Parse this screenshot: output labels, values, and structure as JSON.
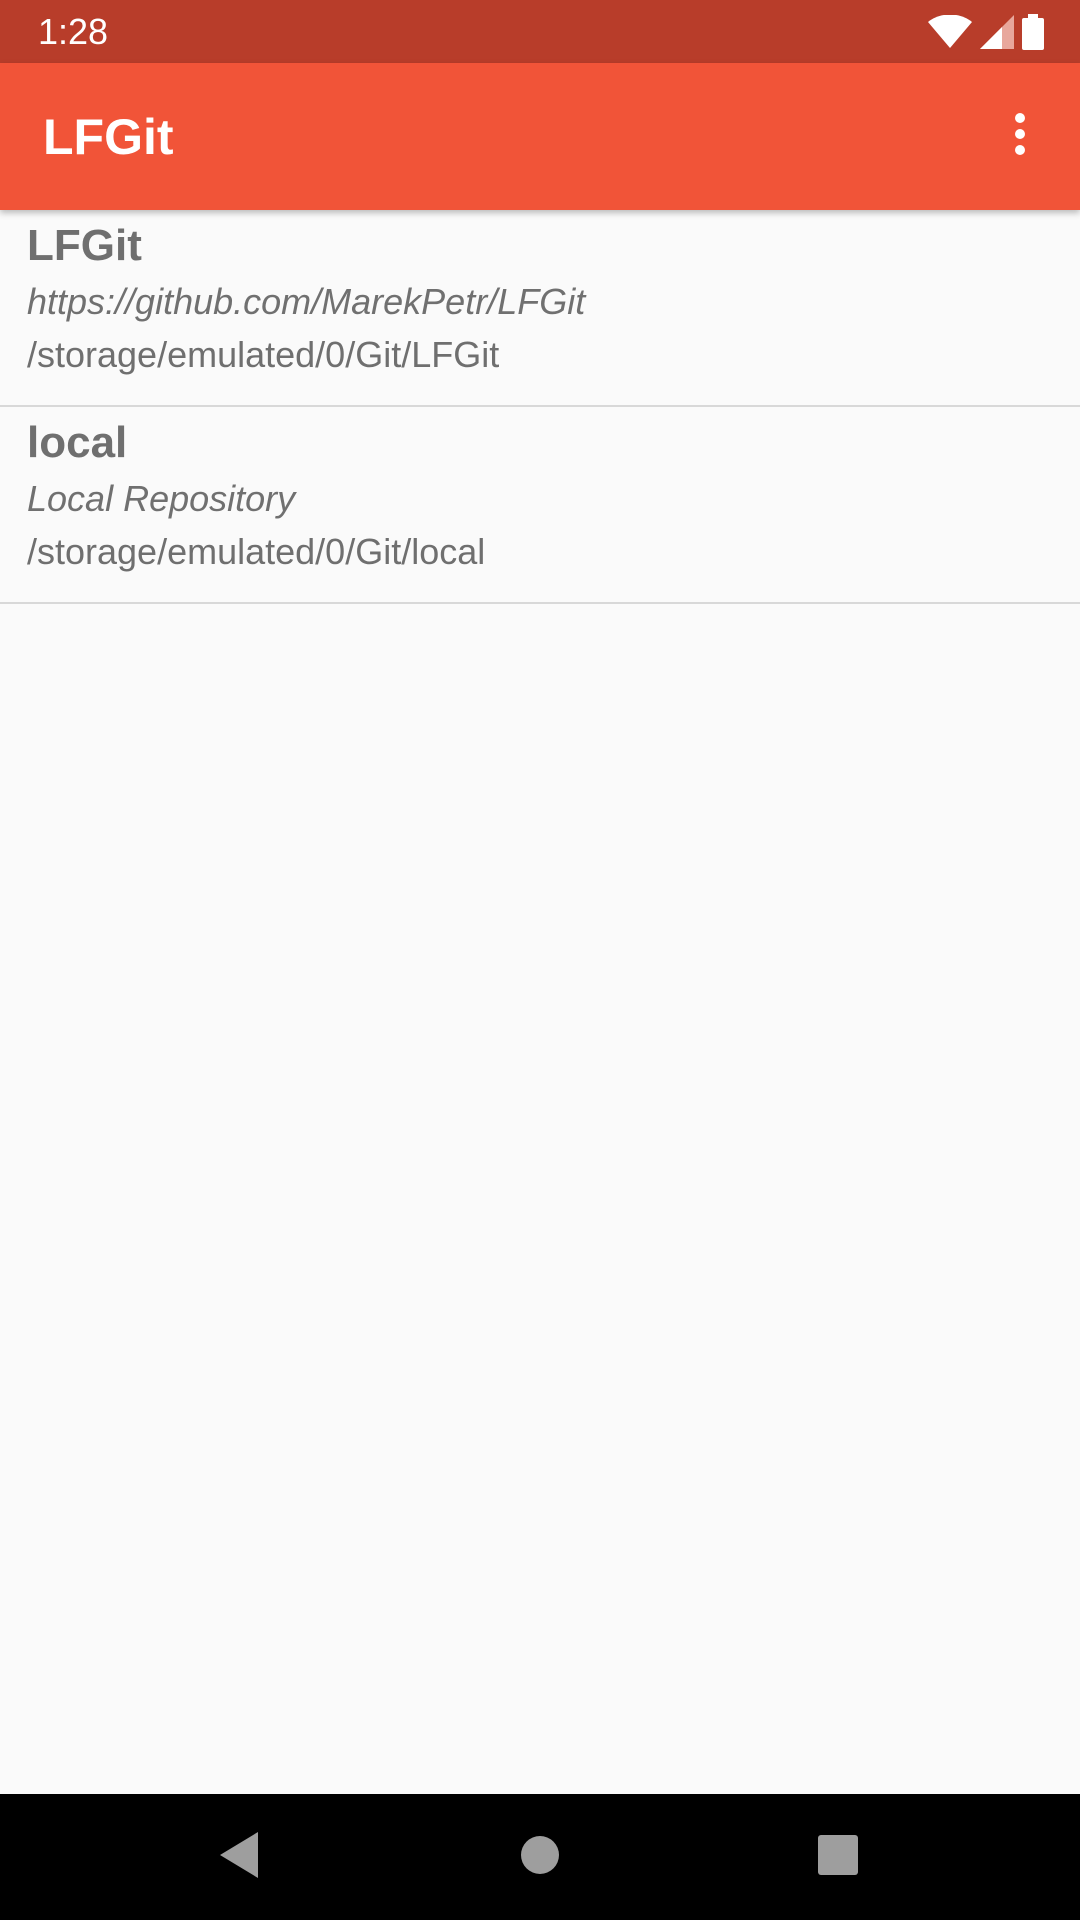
{
  "status_bar": {
    "time": "1:28",
    "icons": [
      "wifi-icon",
      "cellular-signal-icon",
      "battery-icon"
    ]
  },
  "app_bar": {
    "title": "LFGit",
    "overflow_icon": "more-vert-icon"
  },
  "repositories": [
    {
      "name": "LFGit",
      "remote": "https://github.com/MarekPetr/LFGit",
      "path": "/storage/emulated/0/Git/LFGit"
    },
    {
      "name": "local",
      "remote": "Local Repository",
      "path": "/storage/emulated/0/Git/local"
    }
  ],
  "nav_bar": {
    "buttons": [
      "back-icon",
      "home-icon",
      "recents-icon"
    ]
  },
  "colors": {
    "status_bar": "#b83d2a",
    "app_bar": "#f15438",
    "background": "#fafafa",
    "text": "#6f6f6f",
    "divider": "#d8d8d8"
  }
}
